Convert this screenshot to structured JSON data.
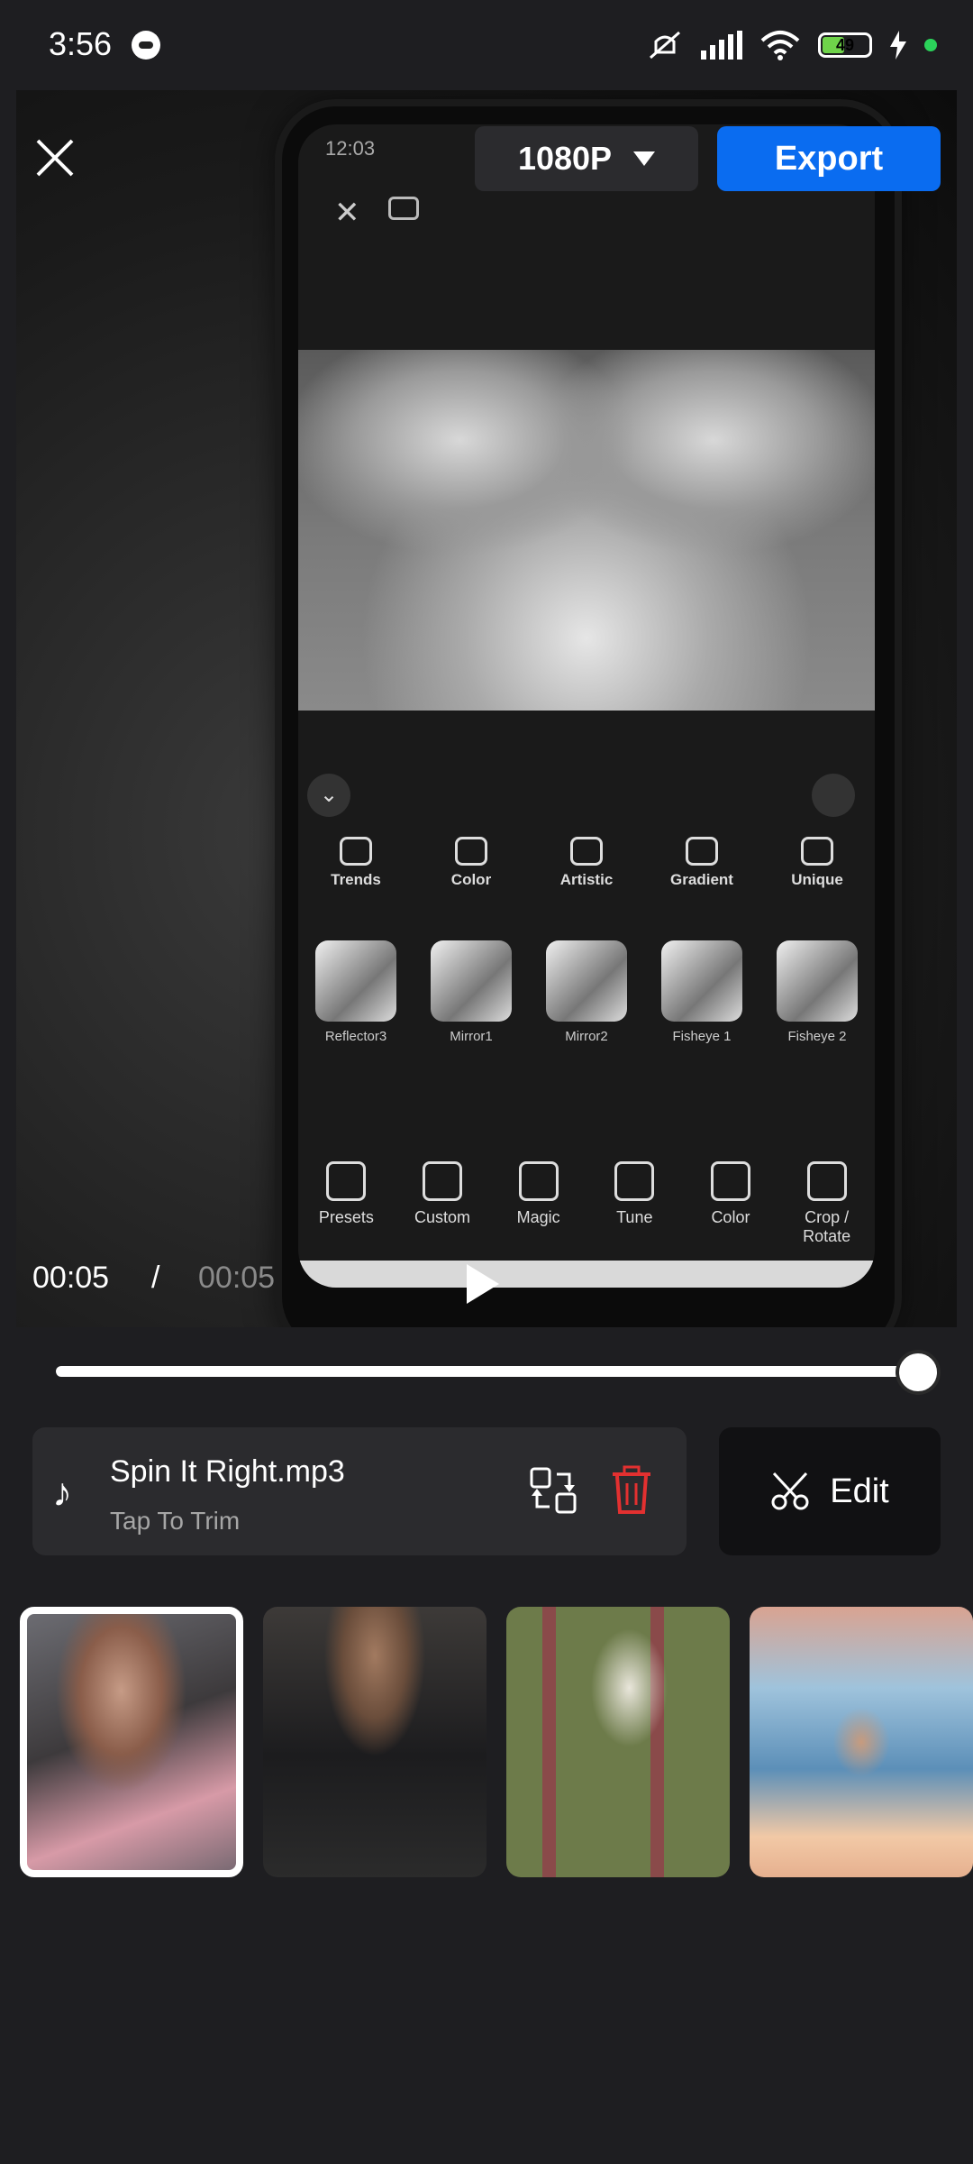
{
  "status_bar": {
    "time": "3:56",
    "battery": "49",
    "accent_battery": "#6fd34a",
    "dot_color": "#2bd35a"
  },
  "editor": {
    "resolution": "1080P",
    "export_label": "Export",
    "export_color": "#0a6cf0",
    "time_current": "00:05",
    "time_separator": "/",
    "time_total": "00:05",
    "progress": 1.0
  },
  "preview_phone": {
    "time": "12:03",
    "categories": [
      "Trends",
      "Color",
      "Artistic",
      "Gradient",
      "Unique"
    ],
    "effects": [
      "Reflector3",
      "Mirror1",
      "Mirror2",
      "Fisheye 1",
      "Fisheye 2"
    ],
    "tools": [
      "Presets",
      "Custom",
      "Magic",
      "Tune",
      "Color",
      "Crop / Rotate"
    ]
  },
  "music": {
    "title": "Spin It Right.mp3",
    "subtitle": "Tap To Trim",
    "trash_color": "#e33030"
  },
  "edit_button": {
    "label": "Edit"
  },
  "thumbnails": [
    {
      "selected": true
    },
    {
      "selected": false
    },
    {
      "selected": false
    },
    {
      "selected": false
    }
  ]
}
